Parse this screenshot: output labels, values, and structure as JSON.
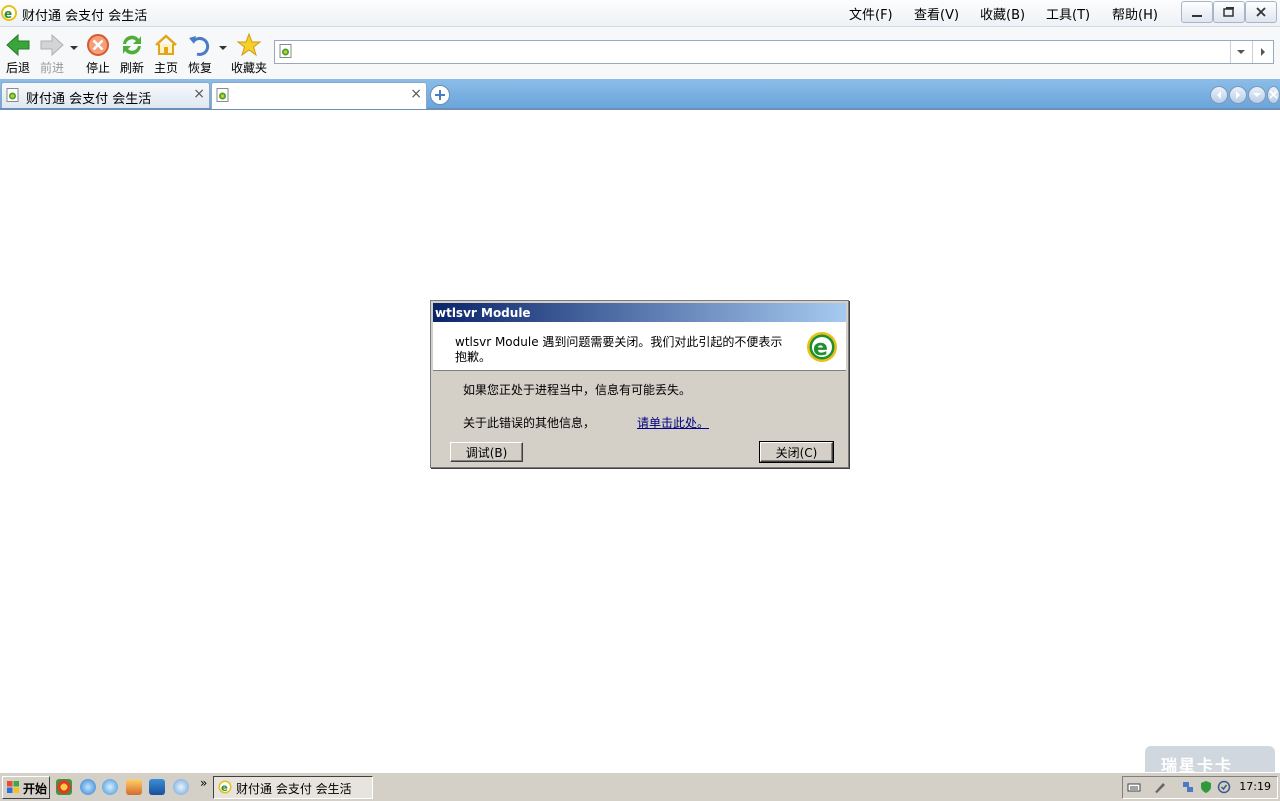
{
  "window": {
    "title": "财付通 会支付 会生活",
    "menu": [
      "文件(F)",
      "查看(V)",
      "收藏(B)",
      "工具(T)",
      "帮助(H)"
    ]
  },
  "toolbar": {
    "back": "后退",
    "forward": "前进",
    "stop": "停止",
    "refresh": "刷新",
    "home": "主页",
    "restore": "恢复",
    "favorites": "收藏夹"
  },
  "address": {
    "value": "",
    "placeholder": ""
  },
  "tabs": [
    {
      "label": "财付通 会支付 会生活"
    },
    {
      "label": ""
    }
  ],
  "dialog": {
    "title": "wtlsvr Module",
    "message": "wtlsvr Module 遇到问题需要关闭。我们对此引起的不便表示抱歉。",
    "data_loss": "如果您正处于进程当中，信息有可能丢失。",
    "more_info": "关于此错误的其他信息，",
    "link": "请单击此处。",
    "debug_button": "调试(B)",
    "close_button": "关闭(C)"
  },
  "taskbar": {
    "start": "开始",
    "more": "»",
    "task_item": "财付通 会支付 会生活",
    "clock": "17:19"
  },
  "watermark": "瑞星卡卡",
  "colors": {
    "tab_strip": "#7ab1e2",
    "dialog_title_start": "#0a246a",
    "dialog_title_end": "#a6caf0",
    "link": "#00007f"
  }
}
